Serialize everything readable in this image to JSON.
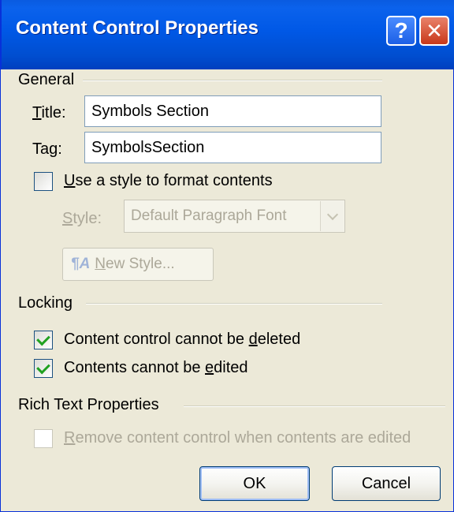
{
  "dialog": {
    "title": "Content Control Properties",
    "help_button": "?",
    "close_button": "✕"
  },
  "general": {
    "heading": "General",
    "title_label_prefix": "",
    "title_label_underline": "T",
    "title_label_rest": "itle:",
    "title_value": "Symbols Section",
    "tag_label_prefix": "Ta",
    "tag_label_underline": "g",
    "tag_label_rest": ":",
    "tag_value": "SymbolsSection",
    "use_style_underline": "U",
    "use_style_rest": "se a style to format contents",
    "use_style_checked": false,
    "style_label_underline": "S",
    "style_label_rest": "tyle:",
    "style_value": "Default Paragraph Font",
    "new_style_underline": "N",
    "new_style_rest": "ew Style..."
  },
  "locking": {
    "heading": "Locking",
    "cannot_delete_prefix": "Content control cannot be ",
    "cannot_delete_underline": "d",
    "cannot_delete_rest": "eleted",
    "cannot_delete_checked": true,
    "cannot_edit_prefix": "Contents cannot be ",
    "cannot_edit_underline": "e",
    "cannot_edit_rest": "dited",
    "cannot_edit_checked": true
  },
  "rich_text": {
    "heading": "Rich Text Properties",
    "remove_underline": "R",
    "remove_rest": "emove content control when contents are edited",
    "remove_checked": false
  },
  "buttons": {
    "ok": "OK",
    "cancel": "Cancel"
  }
}
